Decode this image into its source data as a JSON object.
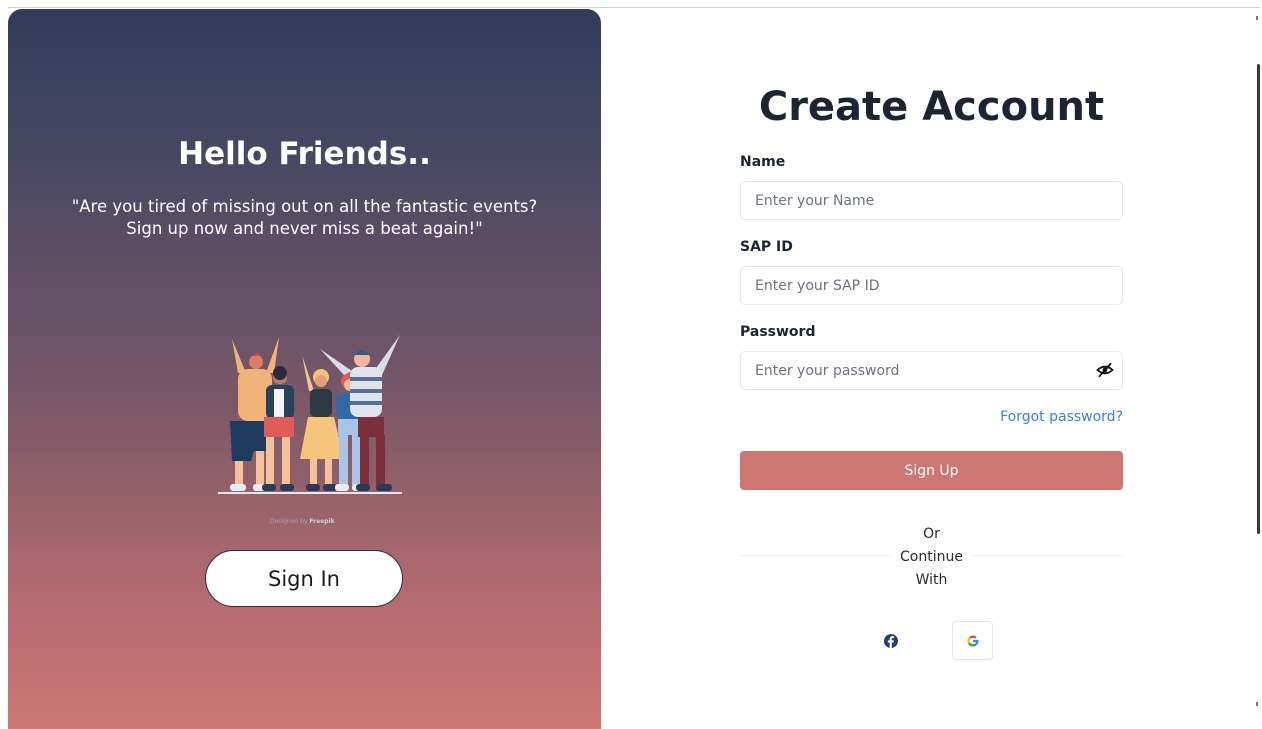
{
  "left_panel": {
    "greeting": "Hello Friends..",
    "quote_line1": "\"Are you tired of missing out on all the fantastic events?",
    "quote_line2": "Sign up now and never miss a beat again!\"",
    "illustration_credit": "Designed by",
    "illustration_credit_brand": "Freepik",
    "signin_label": "Sign In"
  },
  "form": {
    "title": "Create Account",
    "name": {
      "label": "Name",
      "placeholder": "Enter your Name",
      "value": ""
    },
    "sap_id": {
      "label": "SAP ID",
      "placeholder": "Enter your SAP ID",
      "value": ""
    },
    "password": {
      "label": "Password",
      "placeholder": "Enter your password",
      "value": "",
      "toggle_icon": "eye-slash-icon"
    },
    "forgot_password": "Forgot password?",
    "signup_label": "Sign Up",
    "divider_line1": "Or",
    "divider_line2": "Continue",
    "divider_line3": "With",
    "social": [
      {
        "name": "facebook",
        "icon": "facebook-icon"
      },
      {
        "name": "google",
        "icon": "google-icon"
      }
    ]
  },
  "colors": {
    "gradient_top": "#313c5a",
    "gradient_bottom": "#cd7674",
    "signup_button": "#cd7672",
    "link": "#3b82d6",
    "title_text": "#1c2434"
  }
}
